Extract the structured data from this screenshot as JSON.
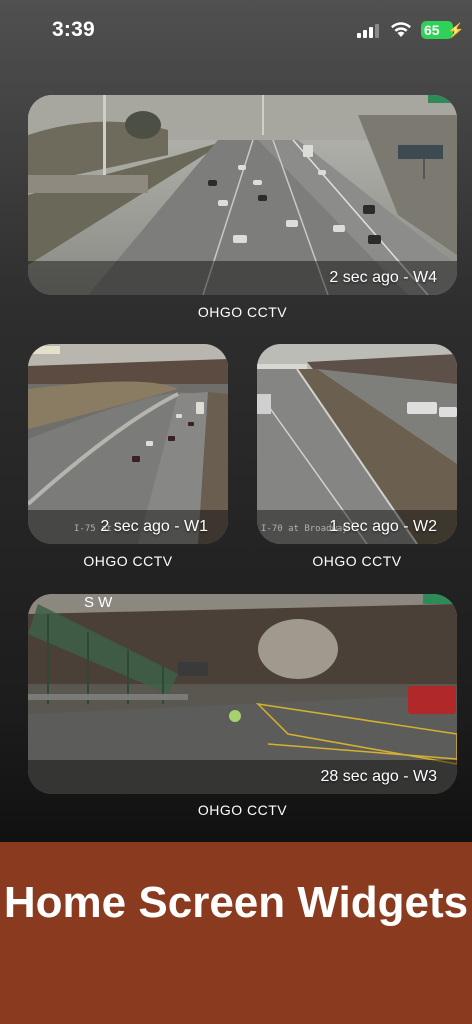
{
  "status_bar": {
    "time": "3:39",
    "battery_level": "65"
  },
  "widgets": {
    "w4": {
      "caption": "2 sec ago - W4",
      "source": "OHGO CCTV"
    },
    "w1": {
      "caption": "2 sec ago - W1",
      "source": "OHGO CCTV",
      "camera_label": "I-75 at"
    },
    "w2": {
      "caption": "1 sec ago - W2",
      "source": "OHGO CCTV",
      "camera_label": "I-70 at Broadway"
    },
    "w3": {
      "caption": "28 sec ago - W3",
      "source": "OHGO CCTV",
      "compass": "S W"
    }
  },
  "banner": {
    "title": "Home Screen Widgets"
  },
  "colors": {
    "banner": "#8a3a1f",
    "battery": "#30d158"
  }
}
